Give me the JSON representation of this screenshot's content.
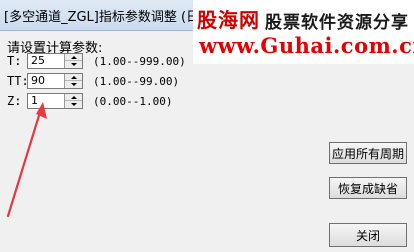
{
  "window": {
    "title": "[多空通道_ZGL]指标参数调整 (日线"
  },
  "watermark": {
    "logo": "股海网",
    "slogan": "股票软件资源分享",
    "url": "www.Guhai.com.cn"
  },
  "form": {
    "prompt": "请设置计算参数:",
    "params": [
      {
        "label": "T:",
        "value": "25",
        "range": "(1.00--999.00)"
      },
      {
        "label": "TT:",
        "value": "90",
        "range": "(1.00--99.00)"
      },
      {
        "label": "Z:",
        "value": "1",
        "range": "(0.00--1.00)"
      }
    ]
  },
  "buttons": {
    "apply_all": "应用所有周期",
    "restore_default": "恢复成缺省",
    "close": "关闭"
  },
  "colors": {
    "annotation_arrow": "#e8383d",
    "watermark_red": "#e60000"
  }
}
